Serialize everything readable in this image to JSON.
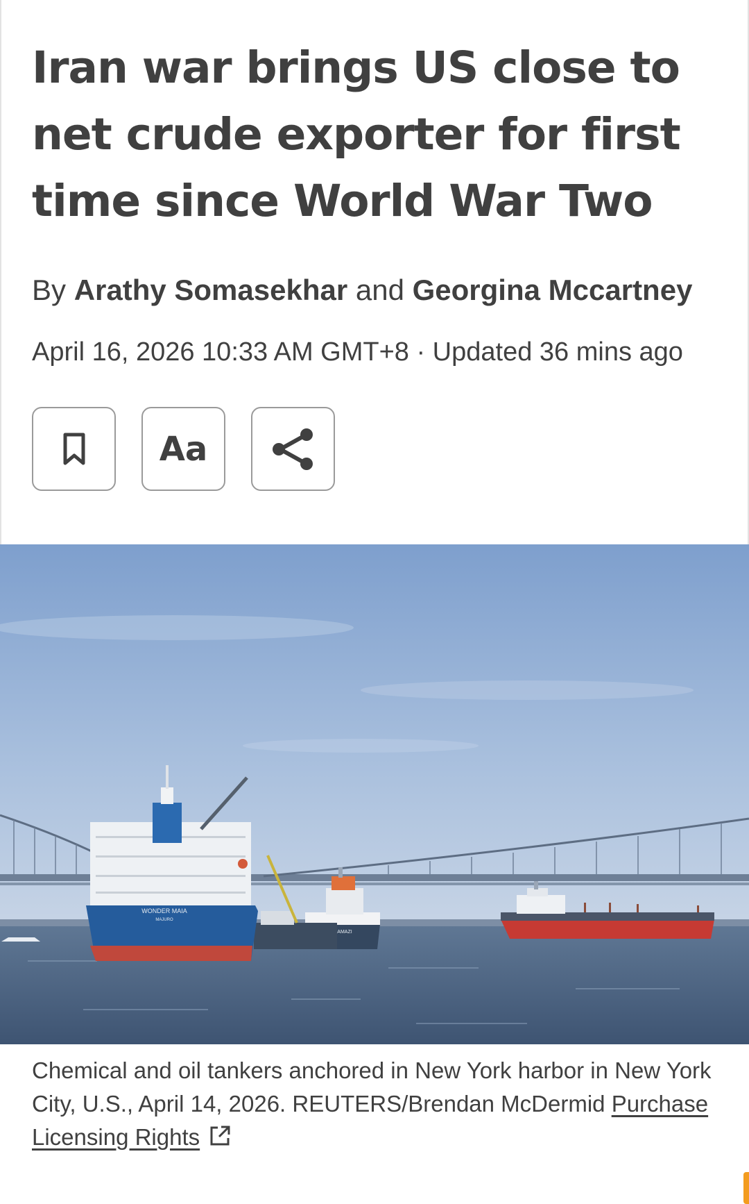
{
  "article": {
    "headline": "Iran war brings US close to net crude exporter for first time since World War Two",
    "byline": {
      "prefix": "By",
      "author1": "Arathy Somasekhar",
      "joiner": "and",
      "author2": "Georgina Mccartney"
    },
    "dateline": "April 16, 2026 10:33 AM GMT+8 · Updated 36 mins ago"
  },
  "actions": {
    "bookmark_icon": "bookmark-icon",
    "font_size_label": "Aa",
    "share_icon": "share-icon"
  },
  "hero": {
    "ship1_name": "WONDER MAIA",
    "ship1_port": "MAJURO",
    "ship2_name": "AMAZI"
  },
  "caption": {
    "text": "Chemical and oil tankers anchored in New York harbor in New York City, U.S., April 14, 2026. REUTERS/Brendan McDermid ",
    "link_label": "Purchase Licensing Rights",
    "link_icon": "external-link-icon"
  },
  "colors": {
    "text": "#404040",
    "border": "#9a9a9a",
    "scroll_indicator": "#f39c1f"
  }
}
